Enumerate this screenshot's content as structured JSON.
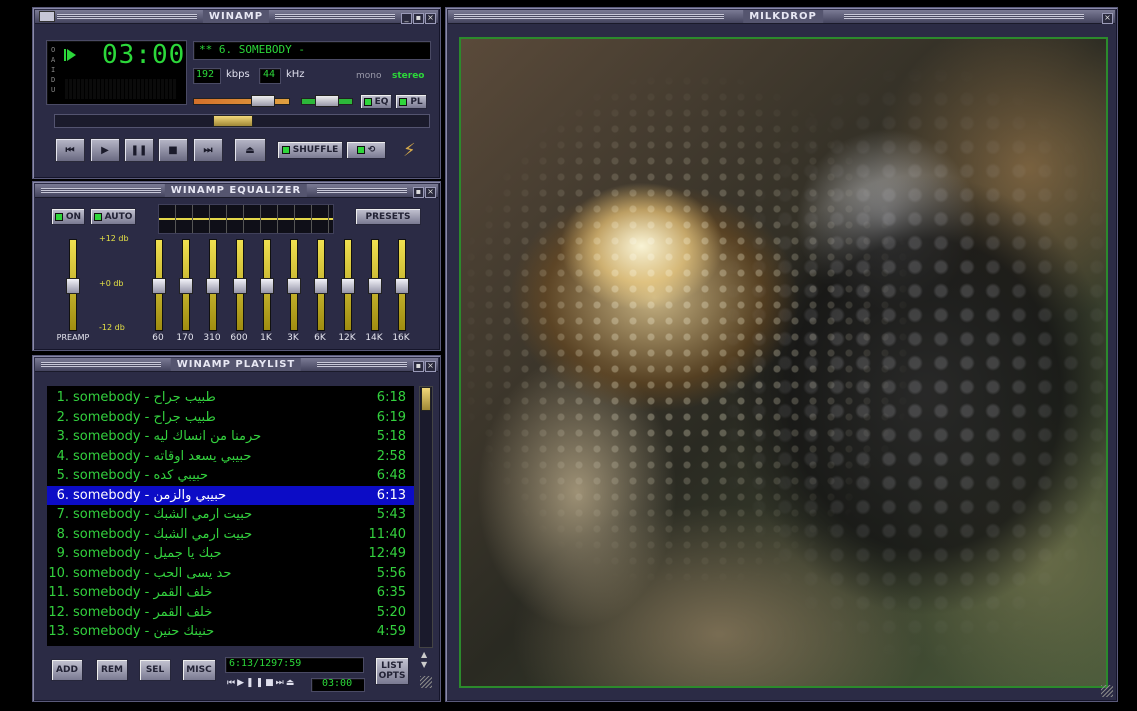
{
  "main_window": {
    "title": "WINAMP",
    "time": "03:00",
    "track_display": "** 6. SOMEBODY -",
    "bitrate": "192",
    "bitrate_unit": "kbps",
    "samplerate": "44",
    "samplerate_unit": "kHz",
    "mono_label": "mono",
    "stereo_label": "stereo",
    "eq_toggle": "EQ",
    "pl_toggle": "PL",
    "shuffle": "SHUFFLE",
    "vis_letters": [
      "O",
      "A",
      "I",
      "D",
      "U"
    ]
  },
  "equalizer": {
    "title": "WINAMP EQUALIZER",
    "on_label": "ON",
    "auto_label": "AUTO",
    "presets_label": "PRESETS",
    "db_top": "+12 db",
    "db_mid": "+0 db",
    "db_bottom": "-12 db",
    "preamp_label": "PREAMP",
    "bands": [
      "60",
      "170",
      "310",
      "600",
      "1K",
      "3K",
      "6K",
      "12K",
      "14K",
      "16K"
    ]
  },
  "playlist": {
    "title": "WINAMP PLAYLIST",
    "items": [
      {
        "num": "1.",
        "title": "somebody - طبيب جراح",
        "dur": "6:18"
      },
      {
        "num": "2.",
        "title": "somebody - طبيب جراح",
        "dur": "6:19"
      },
      {
        "num": "3.",
        "title": "somebody - حرمنا من انساك ليه",
        "dur": "5:18"
      },
      {
        "num": "4.",
        "title": "somebody - حبيبي يسعد اوقاته",
        "dur": "2:58"
      },
      {
        "num": "5.",
        "title": "somebody - حبيبي كده",
        "dur": "6:48"
      },
      {
        "num": "6.",
        "title": "somebody - حبيبي والزمن",
        "dur": "6:13"
      },
      {
        "num": "7.",
        "title": "somebody - حبيت ارمي الشبك",
        "dur": "5:43"
      },
      {
        "num": "8.",
        "title": "somebody - حبيت ارمي الشبك",
        "dur": "11:40"
      },
      {
        "num": "9.",
        "title": "somebody - حبك يا جميل",
        "dur": "12:49"
      },
      {
        "num": "10.",
        "title": "somebody - حد يسى الحب",
        "dur": "5:56"
      },
      {
        "num": "11.",
        "title": "somebody - خلف القمر",
        "dur": "6:35"
      },
      {
        "num": "12.",
        "title": "somebody - خلف القمر",
        "dur": "5:20"
      },
      {
        "num": "13.",
        "title": "somebody - حنينك حنين",
        "dur": "4:59"
      }
    ],
    "selected_index": 5,
    "add_label": "ADD",
    "rem_label": "REM",
    "sel_label": "SEL",
    "misc_label": "MISC",
    "time_info": "6:13/1297:59",
    "mini_time": "03:00",
    "list_opts_line1": "LIST",
    "list_opts_line2": "OPTS"
  },
  "milkdrop": {
    "title": "MILKDROP"
  }
}
